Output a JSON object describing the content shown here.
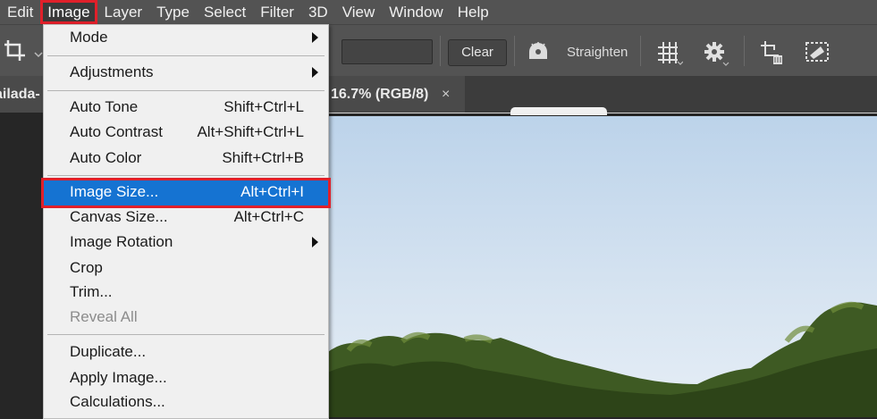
{
  "menubar": {
    "items": [
      {
        "label": "Edit",
        "active": false
      },
      {
        "label": "Image",
        "active": true
      },
      {
        "label": "Layer",
        "active": false
      },
      {
        "label": "Type",
        "active": false
      },
      {
        "label": "Select",
        "active": false
      },
      {
        "label": "Filter",
        "active": false
      },
      {
        "label": "3D",
        "active": false
      },
      {
        "label": "View",
        "active": false
      },
      {
        "label": "Window",
        "active": false
      },
      {
        "label": "Help",
        "active": false
      }
    ]
  },
  "options_bar": {
    "crop_tool_icon": "crop-icon",
    "clear_label": "Clear",
    "straighten_label": "Straighten",
    "straighten_icon": "straighten-icon",
    "grid_icon": "grid-overlay-icon",
    "settings_icon": "gear-icon",
    "delete_cropped_icon": "delete-cropped-pixels-icon",
    "content_aware_icon": "content-aware-icon"
  },
  "document_tabs": [
    {
      "label": "ailada-",
      "partial": true
    },
    {
      "label": "16.7% (RGB/8)",
      "close": "×"
    }
  ],
  "image_menu": {
    "items": [
      {
        "label": "Mode",
        "shortcut": "",
        "submenu": true
      },
      {
        "label": "Adjustments",
        "shortcut": "",
        "submenu": true
      },
      {
        "label": "Auto Tone",
        "shortcut": "Shift+Ctrl+L",
        "submenu": false
      },
      {
        "label": "Auto Contrast",
        "shortcut": "Alt+Shift+Ctrl+L",
        "submenu": false
      },
      {
        "label": "Auto Color",
        "shortcut": "Shift+Ctrl+B",
        "submenu": false
      },
      {
        "label": "Image Size...",
        "shortcut": "Alt+Ctrl+I",
        "submenu": false,
        "highlighted": true
      },
      {
        "label": "Canvas Size...",
        "shortcut": "Alt+Ctrl+C",
        "submenu": false
      },
      {
        "label": "Image Rotation",
        "shortcut": "",
        "submenu": true
      },
      {
        "label": "Crop",
        "shortcut": "",
        "submenu": false
      },
      {
        "label": "Trim...",
        "shortcut": "",
        "submenu": false
      },
      {
        "label": "Reveal All",
        "shortcut": "",
        "submenu": false,
        "disabled": true
      },
      {
        "label": "Duplicate...",
        "shortcut": "",
        "submenu": false
      },
      {
        "label": "Apply Image...",
        "shortcut": "",
        "submenu": false
      },
      {
        "label": "Calculations...",
        "shortcut": "",
        "submenu": false
      }
    ]
  },
  "colors": {
    "highlight": "#1573d2",
    "annotation_red": "#e0202a",
    "menubar_bg": "#535353",
    "menu_bg": "#f0f0f0"
  }
}
